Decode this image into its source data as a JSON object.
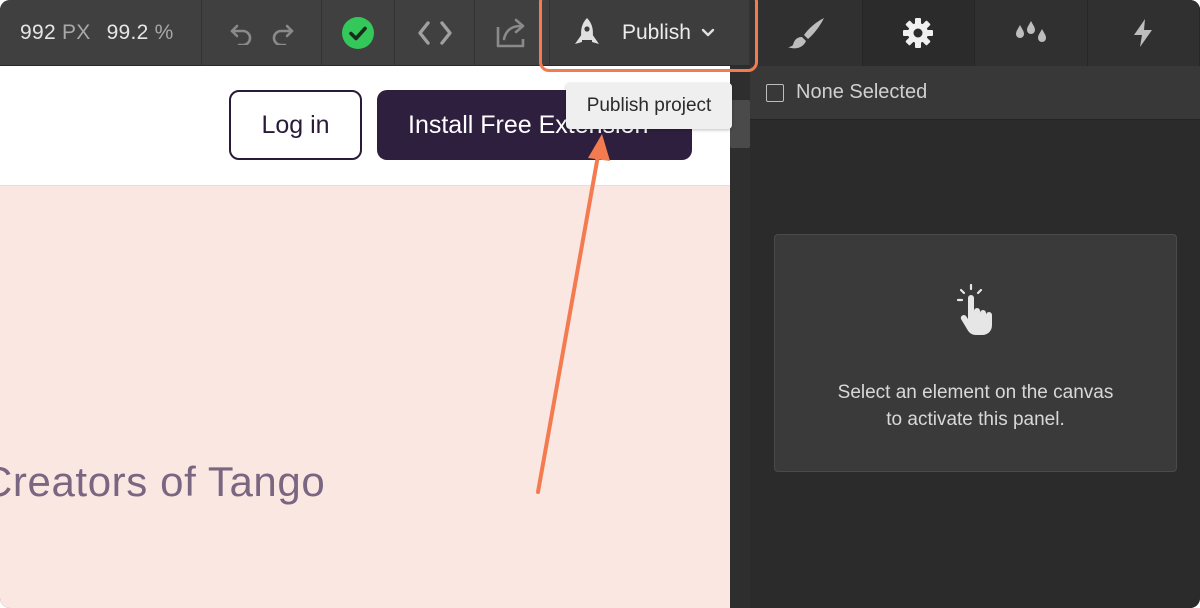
{
  "toolbar": {
    "width_value": "992",
    "width_unit": "PX",
    "zoom_value": "99.2",
    "zoom_unit": "%",
    "undo_icon": "undo-icon",
    "redo_icon": "redo-icon",
    "status_icon": "check-circle-icon",
    "code_icon": "code-icon",
    "export_icon": "export-icon",
    "publish_icon": "rocket-icon",
    "publish_label": "Publish",
    "publish_chevron": "chevron-down-icon"
  },
  "tooltip": {
    "text": "Publish project"
  },
  "panel": {
    "tabs": [
      {
        "icon": "brush-icon"
      },
      {
        "icon": "gear-icon"
      },
      {
        "icon": "drops-icon"
      },
      {
        "icon": "lightning-icon"
      }
    ],
    "none_selected": "None Selected",
    "empty_line1": "Select an element on the canvas",
    "empty_line2": "to activate this panel."
  },
  "canvas": {
    "login_label": "Log in",
    "install_label": "Install Free Extension",
    "hero_text": "Creators of Tango"
  },
  "colors": {
    "toolbar_bg": "#404040",
    "panel_bg": "#2b2b2b",
    "canvas_bg": "#fbe7e2",
    "accent_check": "#34c759",
    "annotation": "#f47b4f",
    "install_bg": "#2e1f3f"
  }
}
